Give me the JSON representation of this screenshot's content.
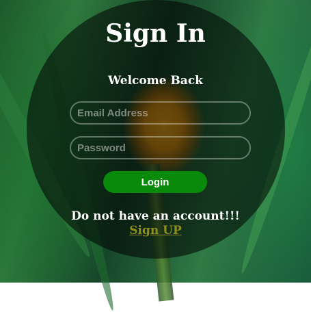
{
  "title": "Sign In",
  "welcome": "Welcome Back",
  "form": {
    "email_placeholder": "Email Address",
    "email_value": "",
    "password_placeholder": "Password",
    "password_value": "",
    "login_label": "Login"
  },
  "footer": {
    "prompt": "Do not have an account!!!",
    "signup_label": "Sign UP"
  },
  "colors": {
    "login_button": "#0a8a0a",
    "signup_link": "#8f8f1e",
    "card_overlay": "rgba(0,0,0,0.55)"
  }
}
